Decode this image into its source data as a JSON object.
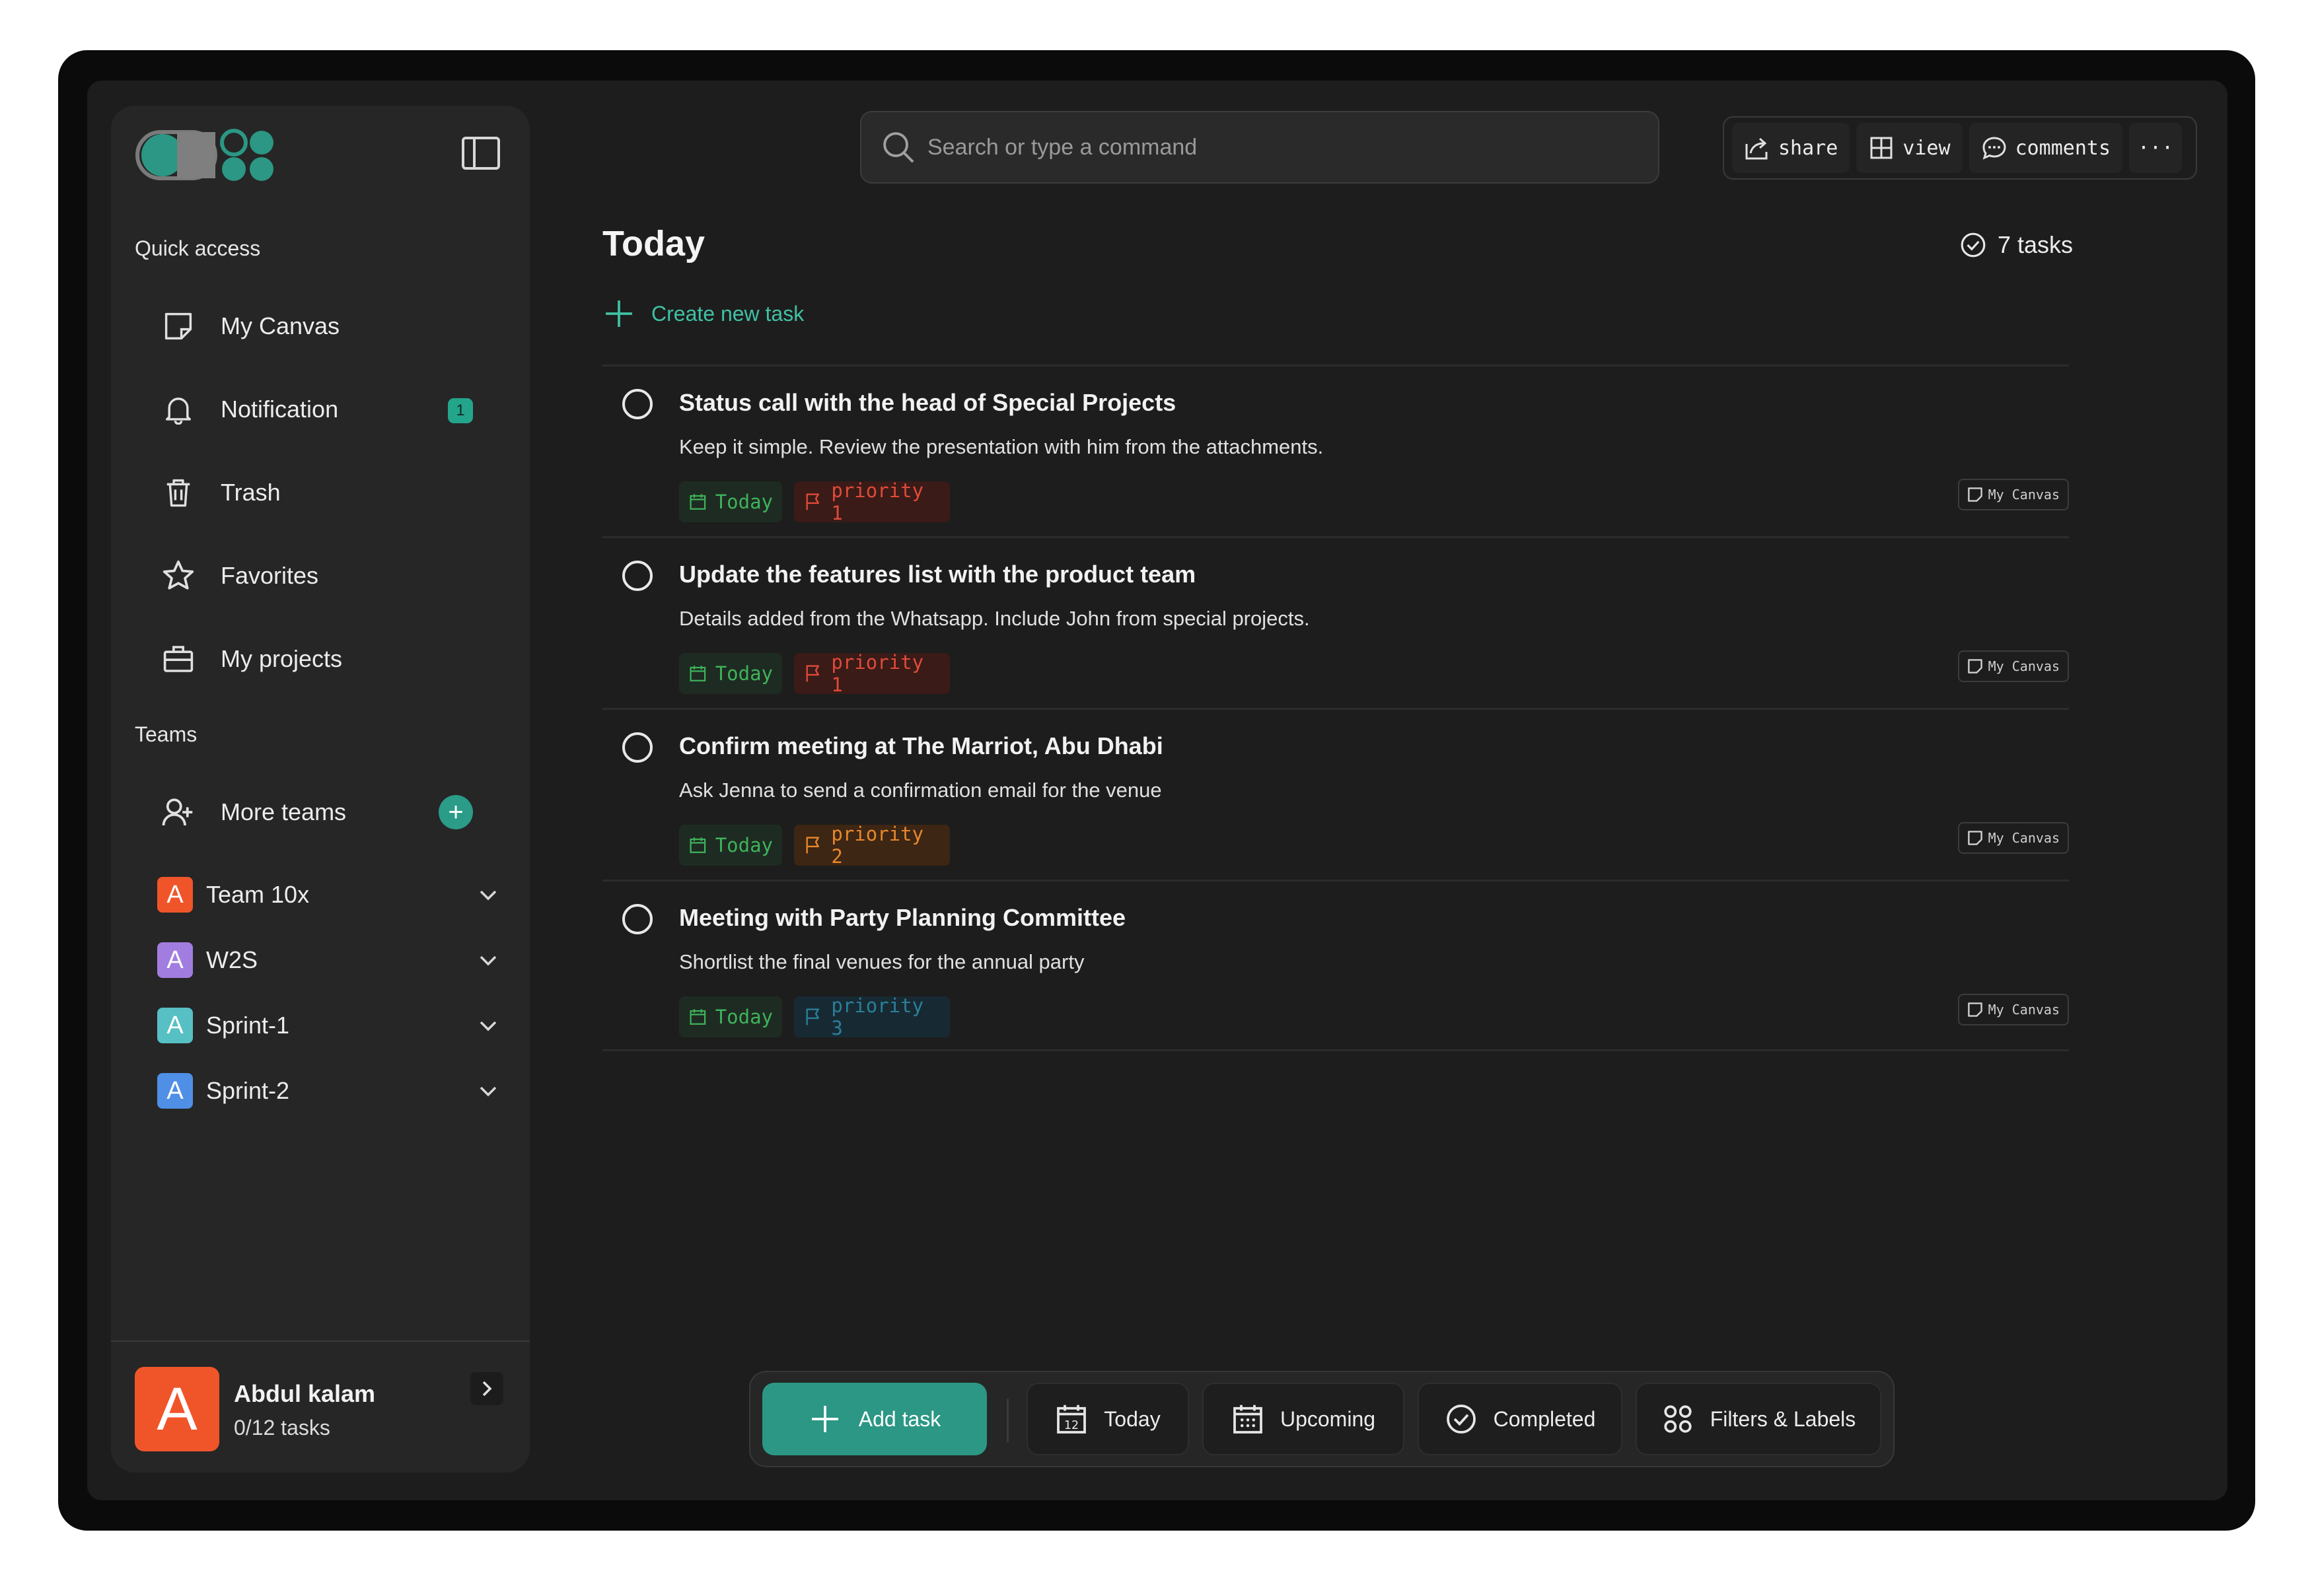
{
  "sidebar": {
    "quick_access_label": "Quick access",
    "quick_access": [
      {
        "label": "My Canvas",
        "icon": "sticky-note-icon"
      },
      {
        "label": "Notification",
        "icon": "bell-icon",
        "badge": "1"
      },
      {
        "label": "Trash",
        "icon": "trash-icon"
      },
      {
        "label": "Favorites",
        "icon": "star-icon"
      },
      {
        "label": "My projects",
        "icon": "briefcase-icon"
      }
    ],
    "teams_label": "Teams",
    "more_teams_label": "More teams",
    "teams": [
      {
        "initial": "A",
        "name": "Team 10x",
        "color": "#f0552a"
      },
      {
        "initial": "A",
        "name": "W2S",
        "color": "#a27de0"
      },
      {
        "initial": "A",
        "name": "Sprint-1",
        "color": "#56c0c4"
      },
      {
        "initial": "A",
        "name": "Sprint-2",
        "color": "#4f8fe6"
      }
    ],
    "user": {
      "initial": "A",
      "name": "Abdul kalam",
      "tasks": "0/12 tasks"
    }
  },
  "search": {
    "placeholder": "Search or type a command"
  },
  "actions": {
    "share": "share",
    "view": "view",
    "comments": "comments",
    "more": "···"
  },
  "main": {
    "title": "Today",
    "task_count": "7 tasks",
    "create_label": "Create new task",
    "tasks": [
      {
        "title": "Status call with the head of Special Projects",
        "desc": "Keep it simple. Review the presentation with him from the attachments.",
        "date": "Today",
        "priority": "priority 1",
        "canvas": "My Canvas"
      },
      {
        "title": "Update the features list with the product team",
        "desc": "Details added from the Whatsapp. Include John from special projects.",
        "date": "Today",
        "priority": "priority 1",
        "canvas": "My Canvas"
      },
      {
        "title": "Confirm meeting at The Marriot, Abu Dhabi",
        "desc": "Ask Jenna to send a confirmation email for the venue",
        "date": "Today",
        "priority": "priority 2",
        "canvas": "My Canvas"
      },
      {
        "title": "Meeting with Party Planning Committee",
        "desc": "Shortlist the final venues for the annual party",
        "date": "Today",
        "priority": "priority 3",
        "canvas": "My Canvas"
      }
    ]
  },
  "bottombar": {
    "add_task": "Add task",
    "today": "Today",
    "upcoming": "Upcoming",
    "completed": "Completed",
    "filters": "Filters & Labels",
    "calendar_day": "12"
  },
  "colors": {
    "accent": "#2b9784",
    "priority1_bg": "#3a1b17",
    "priority1_fg": "#e04a3a",
    "priority2_bg": "#3d2613",
    "priority2_fg": "#e8872c",
    "priority3_bg": "#172a33",
    "priority3_fg": "#2b7f9b"
  }
}
